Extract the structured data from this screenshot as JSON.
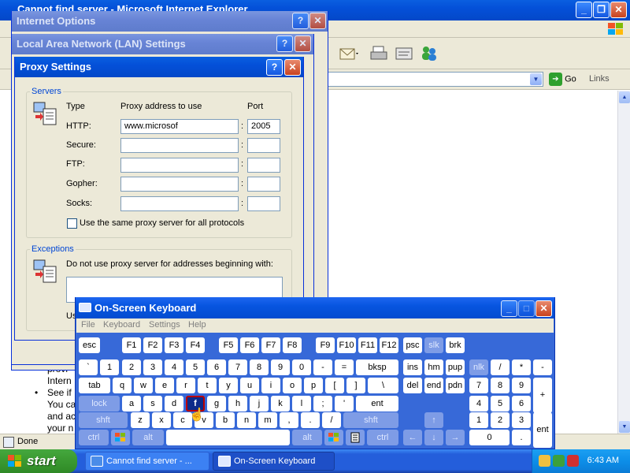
{
  "ie": {
    "title": "Cannot find server - Microsoft Internet Explorer",
    "go_label": "Go",
    "links_label": "Links",
    "status": "Done",
    "content_lines": [
      "provi",
      "Intern",
      "See if",
      "You ca",
      "and ac",
      "your n"
    ],
    "bullet": "•"
  },
  "internet_options": {
    "title": "Internet Options"
  },
  "lan_settings": {
    "title": "Local Area Network (LAN) Settings"
  },
  "proxy_settings": {
    "title": "Proxy Settings",
    "servers_legend": "Servers",
    "col_type": "Type",
    "col_address": "Proxy address to use",
    "col_port": "Port",
    "rows": [
      {
        "type": "HTTP:",
        "address": "www.microsof",
        "port": "2005"
      },
      {
        "type": "Secure:",
        "address": "",
        "port": ""
      },
      {
        "type": "FTP:",
        "address": "",
        "port": ""
      },
      {
        "type": "Gopher:",
        "address": "",
        "port": ""
      },
      {
        "type": "Socks:",
        "address": "",
        "port": ""
      }
    ],
    "colon": ":",
    "same_proxy_label": "Use the same proxy server for all protocols",
    "exceptions_legend": "Exceptions",
    "exceptions_text": "Do not use proxy server for addresses beginning with:",
    "use_label_fragment": "Us"
  },
  "osk": {
    "title": "On-Screen Keyboard",
    "menu": [
      "File",
      "Keyboard",
      "Settings",
      "Help"
    ],
    "keys": {
      "esc": "esc",
      "f1": "F1",
      "f2": "F2",
      "f3": "F3",
      "f4": "F4",
      "f5": "F5",
      "f6": "F6",
      "f7": "F7",
      "f8": "F8",
      "f9": "F9",
      "f10": "F10",
      "f11": "F11",
      "f12": "F12",
      "psc": "psc",
      "slk": "slk",
      "brk": "brk",
      "backtick": "`",
      "n1": "1",
      "n2": "2",
      "n3": "3",
      "n4": "4",
      "n5": "5",
      "n6": "6",
      "n7": "7",
      "n8": "8",
      "n9": "9",
      "n0": "0",
      "minus": "-",
      "equals": "=",
      "bksp": "bksp",
      "ins": "ins",
      "hm": "hm",
      "pup": "pup",
      "nlk": "nlk",
      "div": "/",
      "mul": "*",
      "sub": "-",
      "tab": "tab",
      "q": "q",
      "w": "w",
      "e": "e",
      "r": "r",
      "t": "t",
      "y": "y",
      "u": "u",
      "i": "i",
      "o": "o",
      "p": "p",
      "lbr": "[",
      "rbr": "]",
      "bslash": "\\",
      "del": "del",
      "end": "end",
      "pdn": "pdn",
      "np7": "7",
      "np8": "8",
      "np9": "9",
      "add": "+",
      "lock": "lock",
      "a": "a",
      "s": "s",
      "d": "d",
      "f": "f",
      "g": "g",
      "h": "h",
      "j": "j",
      "k": "k",
      "l": "l",
      "semi": ";",
      "quote": "'",
      "ent": "ent",
      "np4": "4",
      "np5": "5",
      "np6": "6",
      "lshft": "shft",
      "z": "z",
      "x": "x",
      "c": "c",
      "v": "v",
      "b": "b",
      "n": "n",
      "m": "m",
      "comma": ",",
      "period": ".",
      "slash": "/",
      "rshft": "shft",
      "up": "↑",
      "np1": "1",
      "np2": "2",
      "np3": "3",
      "npent": "ent",
      "lctrl": "ctrl",
      "lalt": "alt",
      "ralt": "alt",
      "rctrl": "ctrl",
      "left": "←",
      "down": "↓",
      "right": "→",
      "np0": "0",
      "npdot": "."
    }
  },
  "taskbar": {
    "start_label": "start",
    "tasks": [
      {
        "label": "Cannot find server - ..."
      },
      {
        "label": "On-Screen Keyboard"
      }
    ],
    "clock": "6:43 AM"
  }
}
